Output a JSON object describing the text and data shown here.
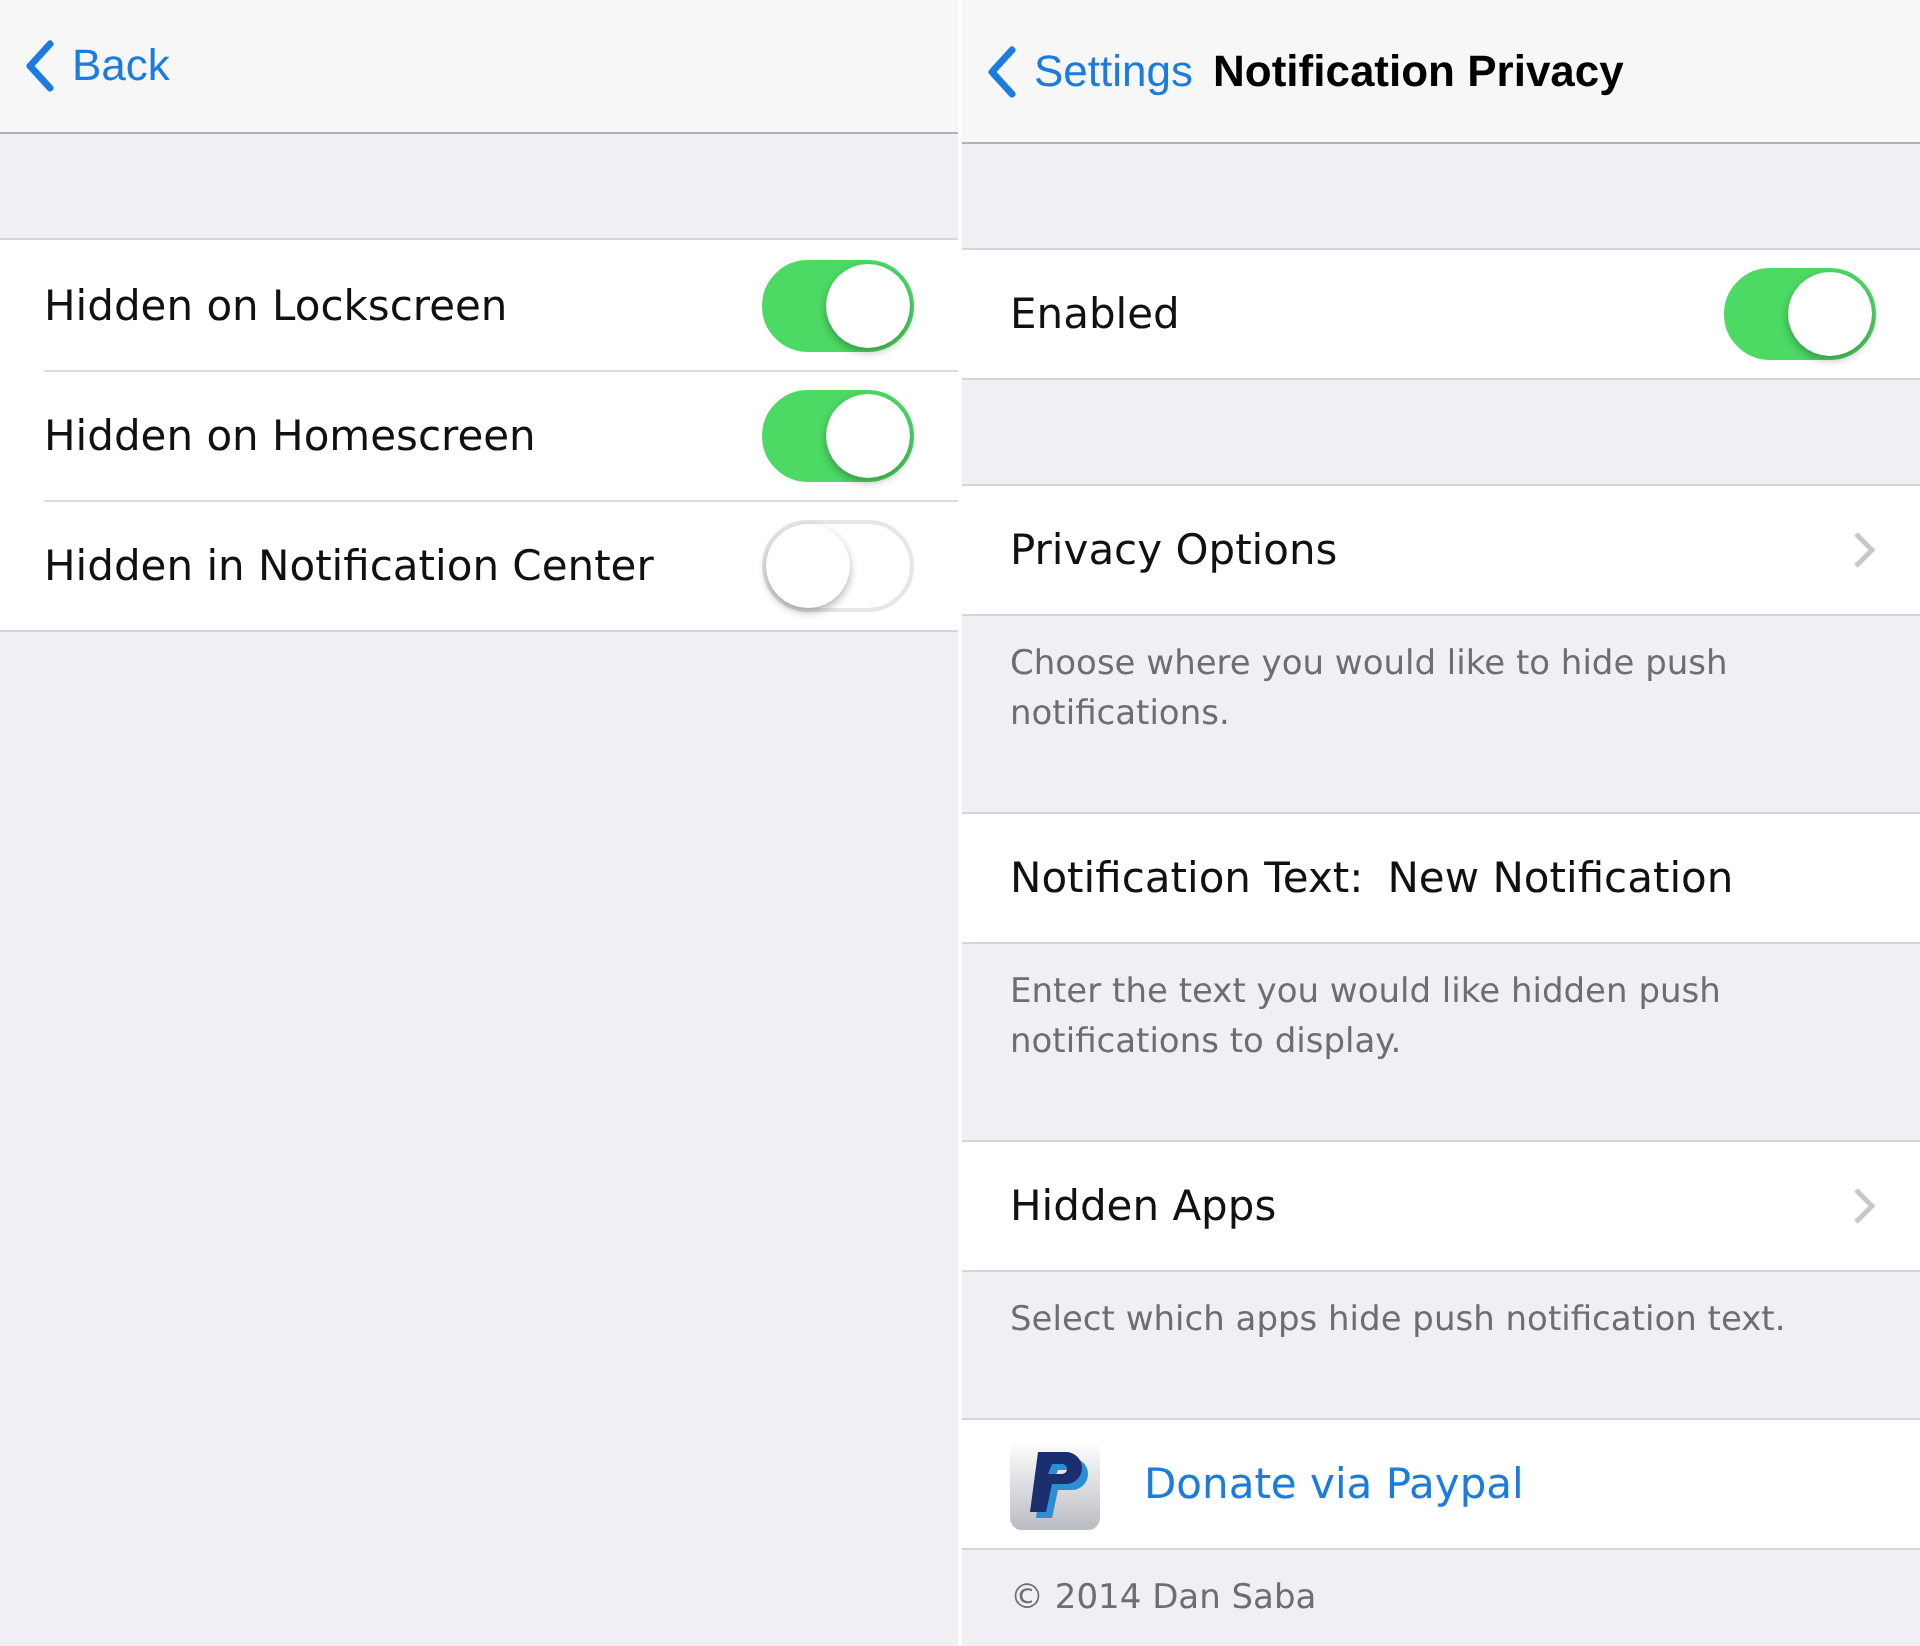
{
  "left_panel": {
    "back_label": "Back",
    "rows": [
      {
        "label": "Hidden on Lockscreen",
        "on": true
      },
      {
        "label": "Hidden on Homescreen",
        "on": true
      },
      {
        "label": "Hidden in Notification Center",
        "on": false
      }
    ]
  },
  "right_panel": {
    "back_label": "Settings",
    "title": "Notification Privacy",
    "sections": [
      {
        "kind": "toggle",
        "label": "Enabled",
        "on": true
      },
      {
        "kind": "link",
        "label": "Privacy Options",
        "footer": "Choose where you would like to hide push notifications."
      },
      {
        "kind": "value",
        "label": "Notification Text:",
        "value": "New Notification",
        "footer": "Enter the text you would like hidden push notifications to display."
      },
      {
        "kind": "link",
        "label": "Hidden Apps",
        "footer": "Select which apps hide push notification text."
      },
      {
        "kind": "donate",
        "label": "Donate via Paypal",
        "footer": "© 2014 Dan Saba"
      }
    ]
  }
}
